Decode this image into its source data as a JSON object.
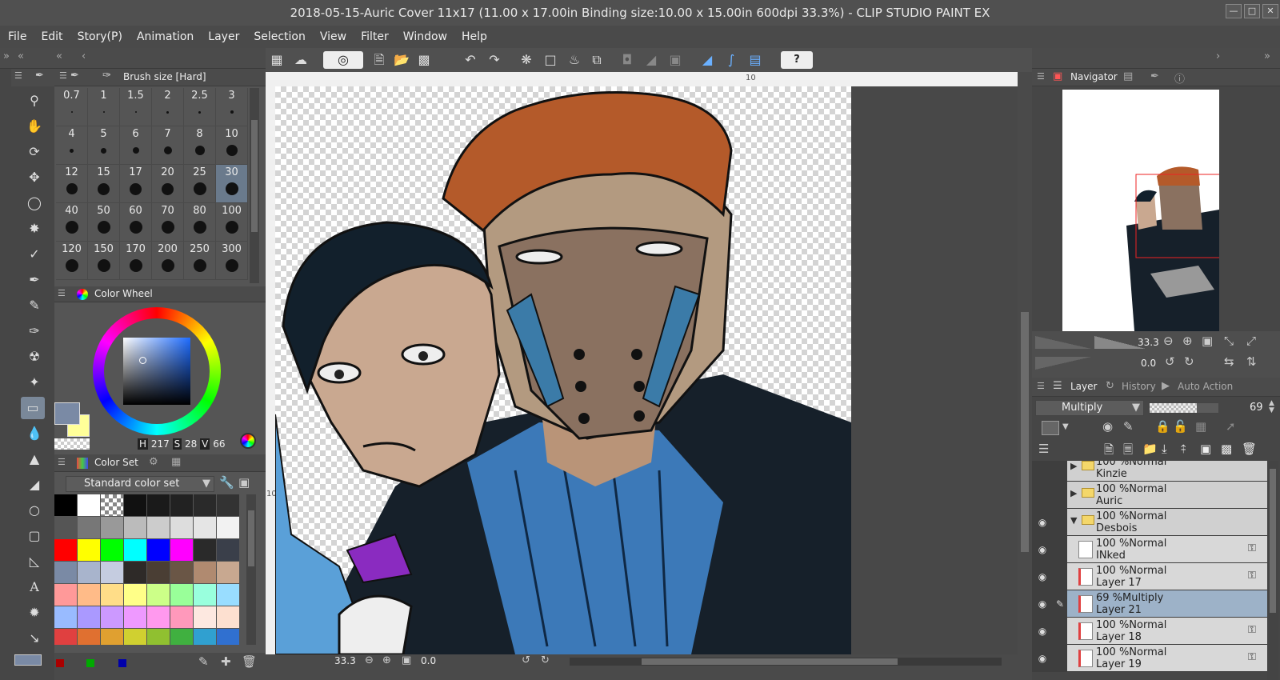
{
  "window": {
    "title": "2018-05-15-Auric Cover 11x17 (11.00 x 17.00in Binding size:10.00 x 15.00in 600dpi 33.3%)  - CLIP STUDIO PAINT EX"
  },
  "menu": [
    "File",
    "Edit",
    "Story(P)",
    "Animation",
    "Layer",
    "Selection",
    "View",
    "Filter",
    "Window",
    "Help"
  ],
  "brush_panel": {
    "tab_label": "Brush size [Hard]",
    "sizes": [
      [
        "0.7",
        "1",
        "1.5",
        "2",
        "2.5",
        "3"
      ],
      [
        "4",
        "5",
        "6",
        "7",
        "8",
        "10"
      ],
      [
        "12",
        "15",
        "17",
        "20",
        "25",
        "30"
      ],
      [
        "40",
        "50",
        "60",
        "70",
        "80",
        "100"
      ],
      [
        "120",
        "150",
        "170",
        "200",
        "250",
        "300"
      ]
    ]
  },
  "color_wheel": {
    "tab_label": "Color Wheel",
    "h_label": "H",
    "h_value": "217",
    "s_label": "S",
    "s_value": "28",
    "v_label": "V",
    "v_value": "66",
    "main_color": "#7a8aa5",
    "sub_color": "#ffff99"
  },
  "color_set": {
    "tab_label": "Color Set",
    "set_name": "Standard color set",
    "swatches": [
      [
        "#000000",
        "#ffffff",
        "checker",
        "#111111",
        "#1a1a1a",
        "#222222",
        "#2a2a2a",
        "#333333"
      ],
      [
        "#555555",
        "#777777",
        "#999999",
        "#bbbbbb",
        "#cccccc",
        "#dddddd",
        "#e5e5e5",
        "#f2f2f2"
      ],
      [
        "#ff0000",
        "#ffff00",
        "#00ff00",
        "#00ffff",
        "#0000ff",
        "#ff00ff",
        "#2a2a2a",
        "#3a3f4a"
      ],
      [
        "#7a8aa5",
        "#a8b4cc",
        "#c5cce0",
        "#2e2a28",
        "#4a3e34",
        "#6a5646",
        "#b08a70",
        "#c8a890"
      ],
      [
        "#ff9999",
        "#ffbb88",
        "#ffdd88",
        "#ffff88",
        "#ccff88",
        "#99ff99",
        "#99ffdd",
        "#99ddff"
      ],
      [
        "#99bbff",
        "#aa99ff",
        "#cc99ff",
        "#ee99ff",
        "#ff99ee",
        "#ff99bb",
        "#fde8e0",
        "#fde0d0"
      ],
      [
        "#e04040",
        "#e07030",
        "#e0a030",
        "#d0d030",
        "#90c030",
        "#40b040",
        "#30a0d0",
        "#3070d0"
      ]
    ]
  },
  "canvas": {
    "ruler_mark_top": "10",
    "ruler_mark_left": "10",
    "zoom": "33.3",
    "rotation": "0.0"
  },
  "navigator": {
    "tab_label": "Navigator",
    "zoom": "33.3",
    "rotation": "0.0"
  },
  "layer_panel": {
    "tabs": [
      "Layer",
      "History",
      "Auto Action"
    ],
    "blend_mode": "Multiply",
    "opacity": "69",
    "layers": [
      {
        "line1": "100 %Normal",
        "line2": "Kinzie",
        "type": "folder",
        "expanded": false,
        "visible": false,
        "selected": false,
        "locked": false
      },
      {
        "line1": "100 %Normal",
        "line2": "Auric",
        "type": "folder",
        "expanded": false,
        "visible": false,
        "selected": false,
        "locked": false
      },
      {
        "line1": "100 %Normal",
        "line2": "Desbois",
        "type": "folder",
        "expanded": true,
        "visible": true,
        "selected": false,
        "locked": false
      },
      {
        "line1": "100 %Normal",
        "line2": "INked",
        "type": "raster",
        "expanded": false,
        "visible": true,
        "selected": false,
        "locked": true
      },
      {
        "line1": "100 %Normal",
        "line2": "Layer 17",
        "type": "raster",
        "expanded": false,
        "visible": true,
        "selected": false,
        "locked": true
      },
      {
        "line1": "69 %Multiply",
        "line2": "Layer 21",
        "type": "raster",
        "expanded": false,
        "visible": true,
        "selected": true,
        "locked": false
      },
      {
        "line1": "100 %Normal",
        "line2": "Layer 18",
        "type": "raster",
        "expanded": false,
        "visible": true,
        "selected": false,
        "locked": true
      },
      {
        "line1": "100 %Normal",
        "line2": "Layer 19",
        "type": "raster",
        "expanded": false,
        "visible": true,
        "selected": false,
        "locked": true
      }
    ]
  },
  "icons": {
    "tools": [
      "zoom-icon",
      "hand-icon",
      "rotate-icon",
      "move-icon",
      "lasso-icon",
      "magic-wand-icon",
      "eyedropper-icon",
      "pen-icon",
      "pencil-icon",
      "brush-icon",
      "airbrush-icon",
      "decoration-icon",
      "eraser-icon",
      "blend-icon",
      "fill-icon",
      "gradient-icon",
      "figure-icon",
      "frame-icon",
      "ruler-icon",
      "text-icon",
      "balloon-icon",
      "correct-line-icon"
    ]
  }
}
